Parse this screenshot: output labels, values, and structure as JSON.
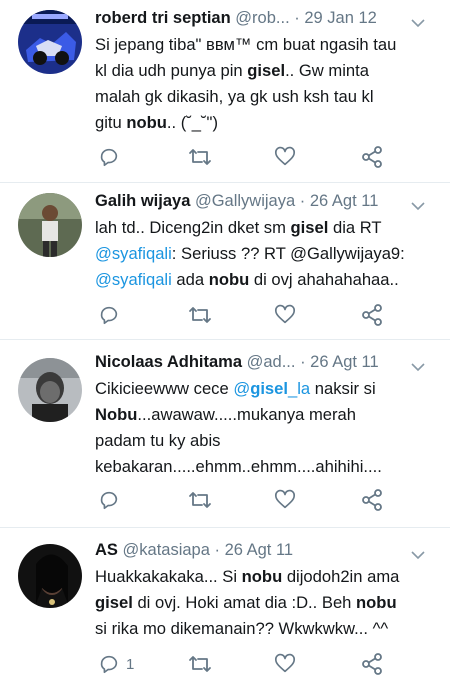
{
  "colors": {
    "link": "#1b95e0",
    "muted": "#657786",
    "divider": "#e6ecf0"
  },
  "icons": [
    "reply-icon",
    "retweet-icon",
    "like-icon",
    "share-icon",
    "chevron-down-icon"
  ],
  "tweets": [
    {
      "name": "roberd tri septian",
      "handle": "@rob...",
      "date": "29 Jan 12",
      "lines": [
        [
          {
            "t": "Si jepang tiba\" ввм™ cm buat ngasih tau"
          }
        ],
        [
          {
            "t": "kl dia udh punya pin "
          },
          {
            "t": "gisel",
            "b": true
          },
          {
            "t": ".. Gw minta"
          }
        ],
        [
          {
            "t": "malah gk dikasih, ya gk ush ksh tau kl"
          }
        ],
        [
          {
            "t": "gitu "
          },
          {
            "t": "nobu",
            "b": true
          },
          {
            "t": ".. (˘_˘\")"
          }
        ]
      ],
      "reply_count": ""
    },
    {
      "name": "Galih wijaya",
      "handle": "@Gallywijaya",
      "date": "26 Agt 11",
      "lines": [
        [
          {
            "t": "lah td.. Diceng2in dket sm "
          },
          {
            "t": "gisel",
            "b": true
          },
          {
            "t": " dia RT"
          }
        ],
        [
          {
            "t": "@syafiqali",
            "m": true
          },
          {
            "t": ": Seriuss ?? RT @Gallywijaya9:"
          }
        ],
        [
          {
            "t": "@syafiqali",
            "m": true
          },
          {
            "t": " ada "
          },
          {
            "t": "nobu",
            "b": true
          },
          {
            "t": " di ovj ahahahahaa.."
          }
        ]
      ],
      "reply_count": ""
    },
    {
      "name": "Nicolaas Adhitama",
      "handle": "@ad...",
      "date": "26 Agt 11",
      "lines": [
        [
          {
            "t": "Cikicieewww cece "
          },
          {
            "t": "@",
            "m": true
          },
          {
            "t": "gisel",
            "b": true,
            "m": true
          },
          {
            "t": "_la",
            "m": true
          },
          {
            "t": " naksir si"
          }
        ],
        [
          {
            "t": "Nobu",
            "b": true
          },
          {
            "t": "...awawaw.....mukanya merah"
          }
        ],
        [
          {
            "t": "padam tu ky abis"
          }
        ],
        [
          {
            "t": "kebakaran.....ehmm..ehmm....ahihihi...."
          }
        ]
      ],
      "reply_count": ""
    },
    {
      "name": "AS",
      "handle": "@katasiapa",
      "date": "26 Agt 11",
      "lines": [
        [
          {
            "t": "Huakkakakaka... Si "
          },
          {
            "t": "nobu",
            "b": true
          },
          {
            "t": " dijodoh2in ama"
          }
        ],
        [
          {
            "t": "gisel",
            "b": true
          },
          {
            "t": " di ovj. Hoki amat dia :D.. Beh "
          },
          {
            "t": "nobu",
            "b": true
          }
        ],
        [
          {
            "t": "si rika mo dikemanain?? Wkwkwkw... ^^"
          }
        ]
      ],
      "reply_count": "1"
    }
  ]
}
